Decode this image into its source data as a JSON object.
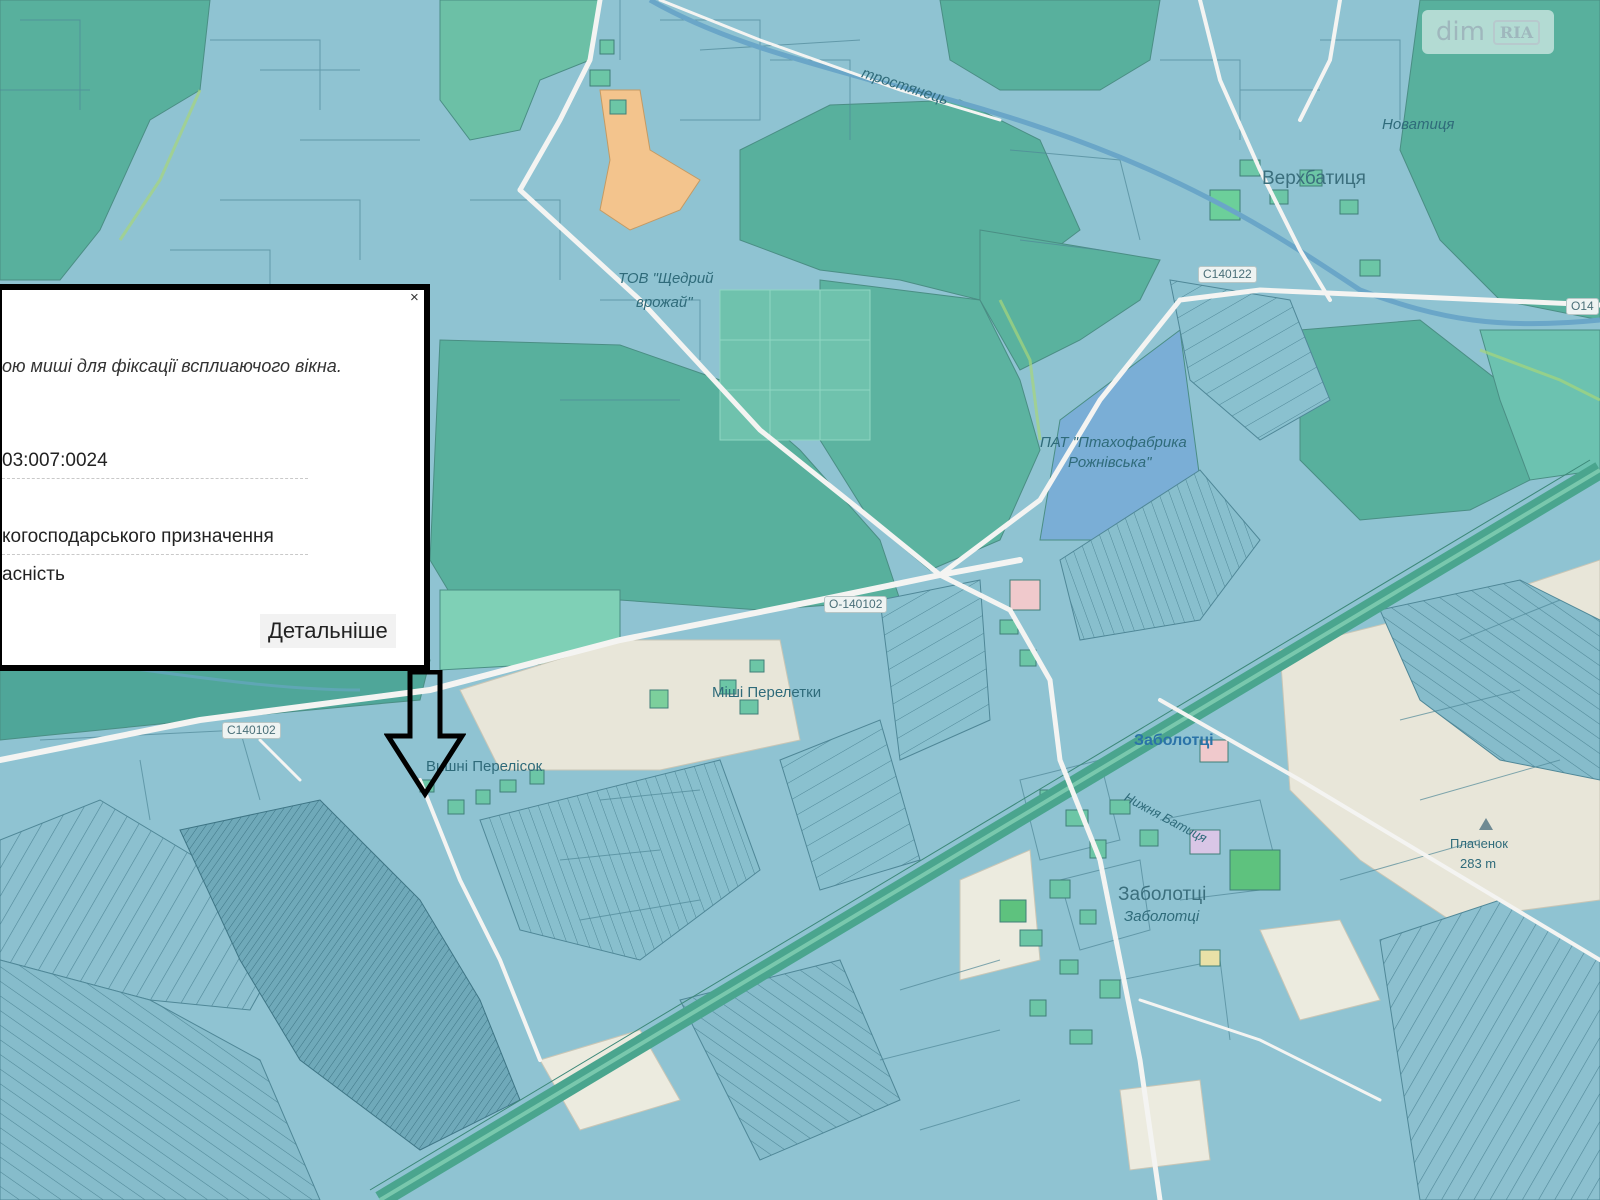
{
  "watermark": {
    "logo_left": "dim",
    "logo_right": "RIA"
  },
  "map": {
    "place_labels": [
      {
        "id": "trostyanets",
        "text": "тростянець"
      },
      {
        "id": "novatiya",
        "text": "Новатиця"
      },
      {
        "id": "verkhbatytsia",
        "text": "Верхбатиця"
      },
      {
        "id": "tov-shchedryi",
        "text": "ТОВ \"Щедрий"
      },
      {
        "id": "tov-shchedryi-2",
        "text": "врожай\""
      },
      {
        "id": "ptakhofabryka",
        "text": "ПАТ \"Птахофабрика"
      },
      {
        "id": "ptakhofabryka-2",
        "text": "Рожнівська\""
      },
      {
        "id": "mshi-pereletki",
        "text": "Міші Перелетки"
      },
      {
        "id": "vyshni-pereleski",
        "text": "Вишні Перелісок"
      },
      {
        "id": "zabolottsi-station",
        "text": "Заболотці"
      },
      {
        "id": "zabolottsi",
        "text": "Заболотці"
      },
      {
        "id": "zabolottsi-2",
        "text": "Заболотці"
      },
      {
        "id": "plachenok",
        "text": "Плаченок"
      },
      {
        "id": "elevation",
        "text": "283 m"
      },
      {
        "id": "nyzhnyi-batytsia",
        "text": "Нижня Батиця"
      }
    ],
    "road_labels": [
      {
        "id": "c140122",
        "text": "C140122"
      },
      {
        "id": "o140102",
        "text": "O-140102"
      },
      {
        "id": "c140102",
        "text": "C140102"
      },
      {
        "id": "o14-right",
        "text": "O14"
      }
    ]
  },
  "popup": {
    "close_label": "×",
    "hint": "ою миші для фіксації всплиаючого вікна.",
    "fields": [
      {
        "id": "cadastral",
        "text": "03:007:0024"
      },
      {
        "id": "purpose",
        "text": "когосподарського призначення"
      },
      {
        "id": "ownership",
        "text": "асність"
      }
    ],
    "more_label": "Детальніше"
  },
  "colors": {
    "forest": "#58b09d",
    "parcel": "#8fc3d2",
    "field_light": "#e8e6d9",
    "road": "#f4f4f2",
    "rail": "#4aa58e",
    "popup_border": "#000000",
    "highlight_orange": "#f3c48d"
  }
}
